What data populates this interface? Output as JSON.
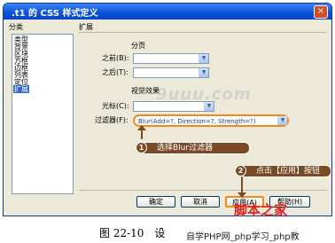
{
  "window": {
    "title": ".t1 的 CSS 样式定义",
    "close_glyph": "×"
  },
  "category_header": "分类",
  "categories": [
    "类型",
    "背景",
    "区块",
    "方框",
    "边框",
    "列表",
    "定位",
    "扩展"
  ],
  "selected_category": "扩展",
  "panel_title": "扩展",
  "paging": {
    "heading": "分页",
    "before_label": "之前(B):",
    "after_label": "之后(T):"
  },
  "visual": {
    "heading": "视觉效果",
    "cursor_label": "光标(C):",
    "filter_label": "过滤器(F):",
    "filter_value": "Blur(Add=?, Direction=?, Strength=?)"
  },
  "buttons": {
    "ok": "确定",
    "cancel": "取消",
    "apply": "应用(A)",
    "help": "帮助(H)"
  },
  "callouts": {
    "step1_num": "1",
    "step1_text": "选择Blur过滤器",
    "step2_num": "2",
    "step2_text": "点击【应用】按钮"
  },
  "caption": "图 22-10　设",
  "watermarks": {
    "red": "脚本之家",
    "site": "自学PHP网_php学习_php教",
    "faint": "9uuu.com"
  },
  "colors": {
    "accent": "#f08a1c",
    "callout_bg": "#7a4a26",
    "selection": "#316ac5"
  },
  "icons": [
    "close-icon",
    "chevron-down-icon",
    "arrow-up-icon"
  ]
}
